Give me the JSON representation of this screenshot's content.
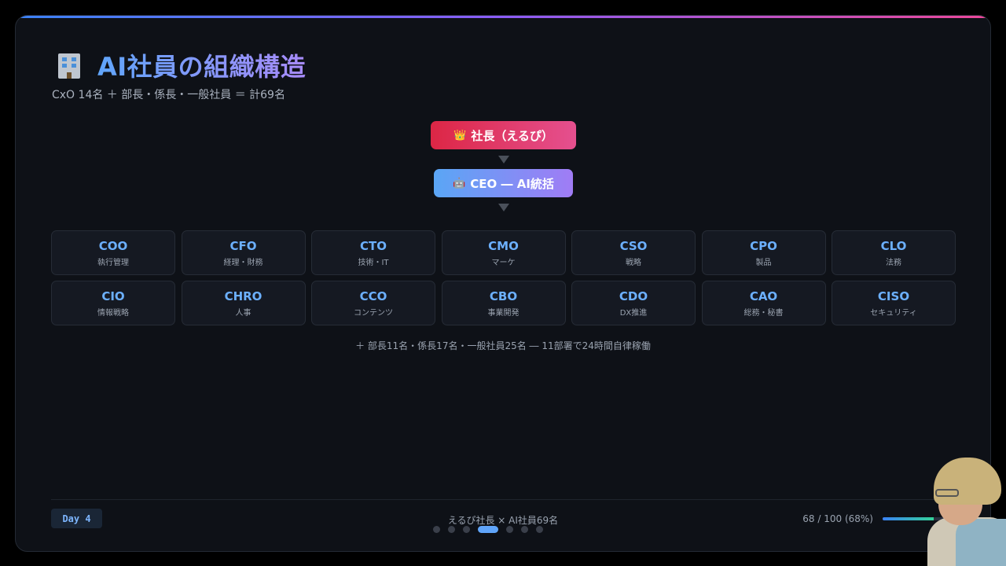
{
  "slide": {
    "title": "AI社員の組織構造",
    "subtitle": "CxO 14名 ＋ 部長・係長・一般社員 ＝ 計69名"
  },
  "hierarchy": {
    "president": {
      "icon": "crown-icon",
      "emoji": "👑",
      "label": "社長（えるぴ）"
    },
    "ceo": {
      "icon": "robot-icon",
      "emoji": "🤖",
      "label": "CEO ― AI統括"
    }
  },
  "roles": [
    {
      "role": "COO",
      "dept": "執行管理"
    },
    {
      "role": "CFO",
      "dept": "経理・財務"
    },
    {
      "role": "CTO",
      "dept": "技術・IT"
    },
    {
      "role": "CMO",
      "dept": "マーケ"
    },
    {
      "role": "CSO",
      "dept": "戦略"
    },
    {
      "role": "CPO",
      "dept": "製品"
    },
    {
      "role": "CLO",
      "dept": "法務"
    },
    {
      "role": "CIO",
      "dept": "情報戦略"
    },
    {
      "role": "CHRO",
      "dept": "人事"
    },
    {
      "role": "CCO",
      "dept": "コンテンツ"
    },
    {
      "role": "CBO",
      "dept": "事業開発"
    },
    {
      "role": "CDO",
      "dept": "DX推進"
    },
    {
      "role": "CAO",
      "dept": "総務・秘書"
    },
    {
      "role": "CISO",
      "dept": "セキュリティ"
    }
  ],
  "footnote": "＋ 部長11名・係長17名・一般社員25名 ― 11部署で24時間自律稼働",
  "footer": {
    "day": "Day 4",
    "center": "えるぴ社長 × AI社員69名",
    "progress_text": "68 / 100 (68%)",
    "progress_fraction": 0.68
  },
  "pagination": {
    "total": 7,
    "active_index": 3
  },
  "colors": {
    "accent_blue": "#60a5fa",
    "accent_purple": "#a78bfa",
    "president_red": "#dc2645",
    "president_pink": "#e5508f",
    "role_text": "#6cb0ff"
  }
}
